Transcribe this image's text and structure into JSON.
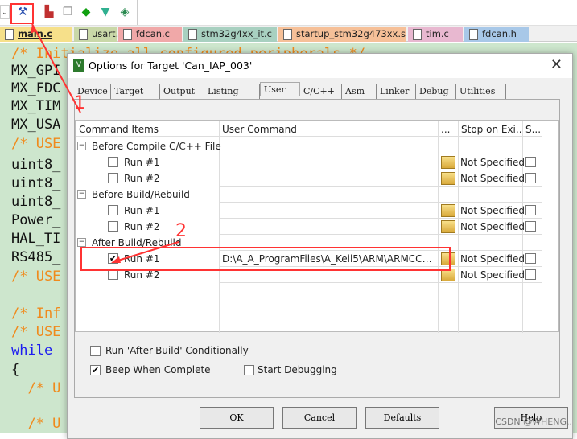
{
  "toolbar": {
    "icons": [
      "manage-project-items-icon",
      "select-packs-icon",
      "copy-icon",
      "pack-installer-icon",
      "filter-icon",
      "manage-runtime-icon"
    ]
  },
  "file_tabs": [
    {
      "label": "main.c",
      "color": "#f6e08a"
    },
    {
      "label": "usart.c",
      "color": "#c9d8a8"
    },
    {
      "label": "fdcan.c",
      "color": "#f0a8a8"
    },
    {
      "label": "stm32g4xx_it.c",
      "color": "#a8d0c0"
    },
    {
      "label": "startup_stm32g473xx.s",
      "color": "#f6c098"
    },
    {
      "label": "tim.c",
      "color": "#e8b8d0"
    },
    {
      "label": "fdcan.h",
      "color": "#a8c8e8"
    }
  ],
  "code_lines": [
    "/* Initialize all configured peripherals */",
    "MX_GPI",
    "MX_FDC",
    "MX_TIM",
    "MX_USA",
    "/* USE",
    "uint8_",
    "uint8_",
    "uint8_",
    "Power_",
    "HAL_TI",
    "RS485_",
    "/* USE",
    "",
    "/* Inf",
    "/* USE",
    "while",
    "{",
    "  /* U",
    "",
    "  /* U"
  ],
  "dialog": {
    "title": "Options for Target 'Can_IAP_003'",
    "tabs": [
      "Device",
      "Target",
      "Output",
      "Listing",
      "User",
      "C/C++",
      "Asm",
      "Linker",
      "Debug",
      "Utilities"
    ],
    "active_tab": "User",
    "grid": {
      "headers": [
        "Command Items",
        "User Command",
        "...",
        "Stop on Exi...",
        "S..."
      ],
      "groups": [
        {
          "label": "Before Compile C/C++ File",
          "runs": [
            {
              "label": "Run #1",
              "checked": false,
              "command": "",
              "stop": "Not Specified"
            },
            {
              "label": "Run #2",
              "checked": false,
              "command": "",
              "stop": "Not Specified"
            }
          ]
        },
        {
          "label": "Before Build/Rebuild",
          "runs": [
            {
              "label": "Run #1",
              "checked": false,
              "command": "",
              "stop": "Not Specified"
            },
            {
              "label": "Run #2",
              "checked": false,
              "command": "",
              "stop": "Not Specified"
            }
          ]
        },
        {
          "label": "After Build/Rebuild",
          "runs": [
            {
              "label": "Run #1",
              "checked": true,
              "command": "D:\\A_A_ProgramFiles\\A_Keil5\\ARM\\ARMCC\\bin...",
              "stop": "Not Specified"
            },
            {
              "label": "Run #2",
              "checked": false,
              "command": "",
              "stop": "Not Specified"
            }
          ]
        }
      ]
    },
    "options": {
      "run_after_build": {
        "label": "Run 'After-Build' Conditionally",
        "checked": false
      },
      "beep": {
        "label": "Beep When Complete",
        "checked": true
      },
      "start_debugging": {
        "label": "Start Debugging",
        "checked": false
      }
    },
    "buttons": {
      "ok": "OK",
      "cancel": "Cancel",
      "defaults": "Defaults",
      "help": "Help"
    }
  },
  "annotations": {
    "step1": "1",
    "step2": "2",
    "color": "#ff3333"
  },
  "watermark": "CSDN @WHENG.."
}
